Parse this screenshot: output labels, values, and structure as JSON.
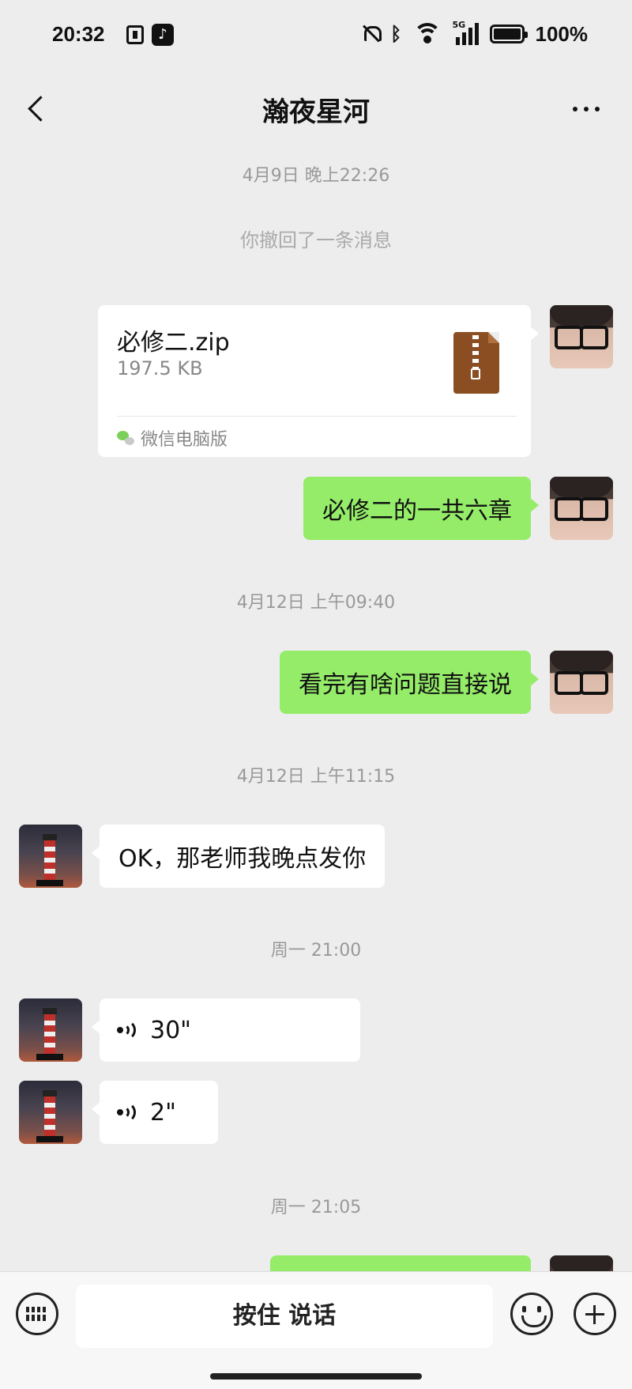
{
  "status_bar": {
    "time": "20:32",
    "battery_percent": "100%",
    "network": "5G",
    "icons": [
      "phone-app-icon",
      "tiktok-icon",
      "mute-bell-icon",
      "bluetooth-icon",
      "wifi-icon",
      "signal-icon",
      "battery-icon"
    ]
  },
  "nav": {
    "title": "瀚夜星河",
    "back_icon": "chevron-left-icon",
    "more_icon": "more-dots-icon"
  },
  "messages": [
    {
      "type": "timestamp",
      "text": "4月9日 晚上22:26"
    },
    {
      "type": "system",
      "text": "你撤回了一条消息"
    },
    {
      "type": "file",
      "from": "me",
      "file_name": "必修二.zip",
      "file_size": "197.5 KB",
      "source": "微信电脑版"
    },
    {
      "type": "text",
      "from": "me",
      "text": "必修二的一共六章"
    },
    {
      "type": "timestamp",
      "text": "4月12日 上午09:40"
    },
    {
      "type": "text",
      "from": "me",
      "text": "看完有啥问题直接说"
    },
    {
      "type": "timestamp",
      "text": "4月12日 上午11:15"
    },
    {
      "type": "text",
      "from": "other",
      "text": "OK，那老师我晚点发你"
    },
    {
      "type": "timestamp",
      "text": "周一 21:00"
    },
    {
      "type": "voice",
      "from": "other",
      "duration": "30\""
    },
    {
      "type": "voice",
      "from": "other",
      "duration": "2\""
    },
    {
      "type": "timestamp",
      "text": "周一 21:05"
    },
    {
      "type": "text",
      "from": "me",
      "text": ""
    }
  ],
  "input_bar": {
    "hold_to_talk": "按住 说话",
    "icons": [
      "keyboard-icon",
      "emoji-icon",
      "plus-icon"
    ]
  },
  "colors": {
    "background": "#ededed",
    "my_bubble": "#95ec69",
    "other_bubble": "#ffffff",
    "timestamp_text": "#999999"
  }
}
